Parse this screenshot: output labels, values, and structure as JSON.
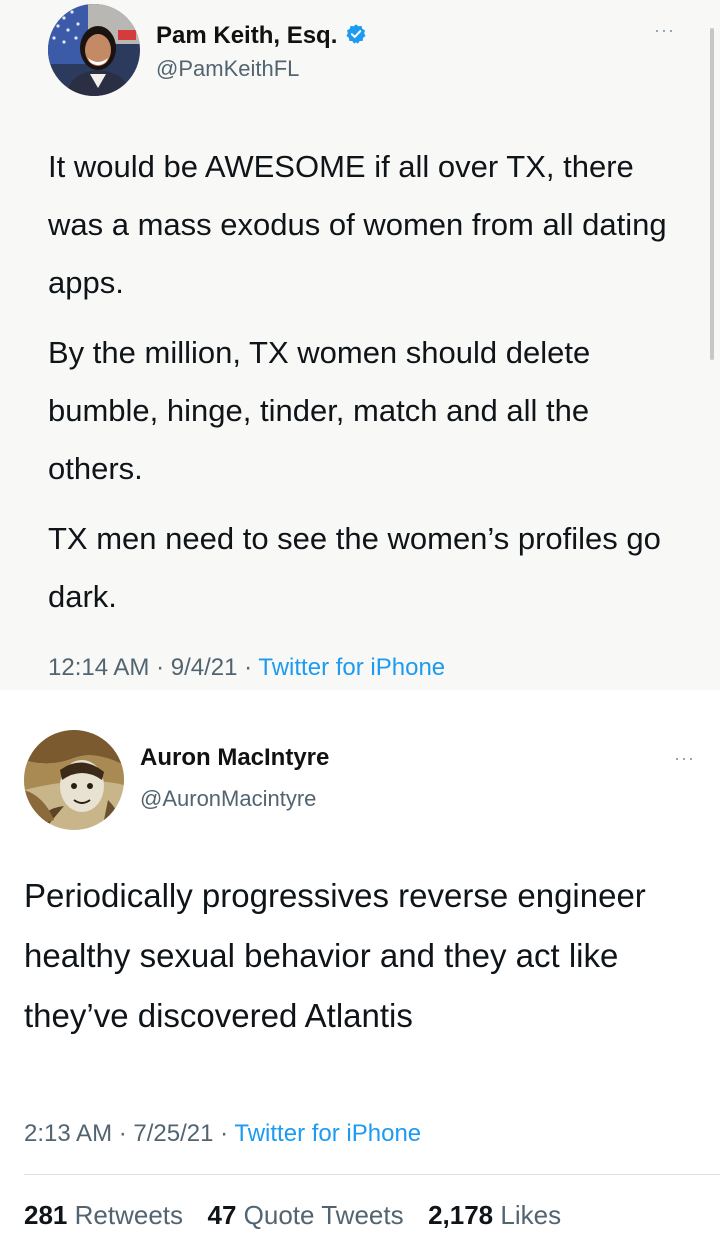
{
  "tweet1": {
    "display_name": "Pam Keith, Esq.",
    "verified": true,
    "handle": "@PamKeithFL",
    "paragraphs": [
      "It would be AWESOME if all over TX, there was a mass exodus of women from all dating apps.",
      "By the million, TX women should delete bumble, hinge, tinder, match and all the others.",
      "TX men need to see the women’s profiles go dark."
    ],
    "time": "12:14 AM",
    "date": "9/4/21",
    "dot": "·",
    "source": "Twitter for iPhone",
    "more_icon": "···"
  },
  "tweet2": {
    "display_name": "Auron MacIntyre",
    "handle": "@AuronMacintyre",
    "paragraphs": [
      "Periodically progressives reverse engineer healthy sexual behavior and they act like they’ve discovered Atlantis"
    ],
    "time": "2:13 AM",
    "date": "7/25/21",
    "dot": "·",
    "source": "Twitter for iPhone",
    "more_icon": "···",
    "stats": {
      "retweets_count": "281",
      "retweets_label": "Retweets",
      "quotes_count": "47",
      "quotes_label": "Quote Tweets",
      "likes_count": "2,178",
      "likes_label": "Likes"
    }
  },
  "colors": {
    "verified": "#1d9bf0",
    "link": "#1d9bf0",
    "secondary_text": "#536471"
  }
}
